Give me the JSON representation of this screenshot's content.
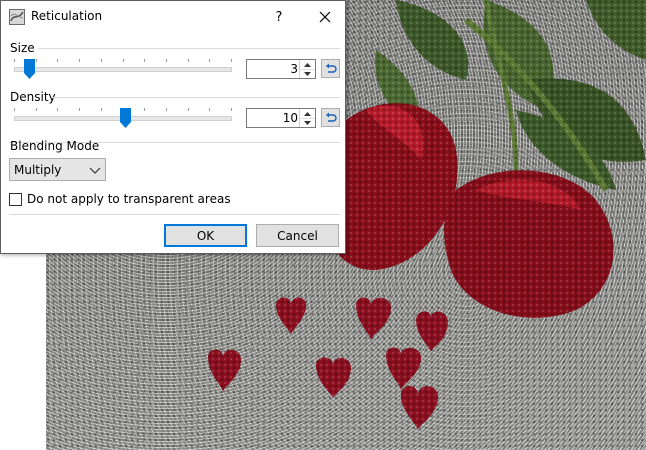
{
  "window": {
    "title": "Reticulation",
    "help_label": "?",
    "icon": "reticulation-app-icon"
  },
  "size": {
    "label": "Size",
    "value": "3",
    "slider_fraction": 0.07
  },
  "density": {
    "label": "Density",
    "value": "10",
    "slider_fraction": 0.51
  },
  "blending": {
    "label": "Blending Mode",
    "selected": "Multiply"
  },
  "transparent_option": {
    "label": "Do not apply to transparent areas",
    "checked": false
  },
  "buttons": {
    "ok": "OK",
    "cancel": "Cancel"
  },
  "colors": {
    "accent": "#0078d7",
    "rose": "#8a0f1a",
    "leaf": "#3f5a2a"
  }
}
